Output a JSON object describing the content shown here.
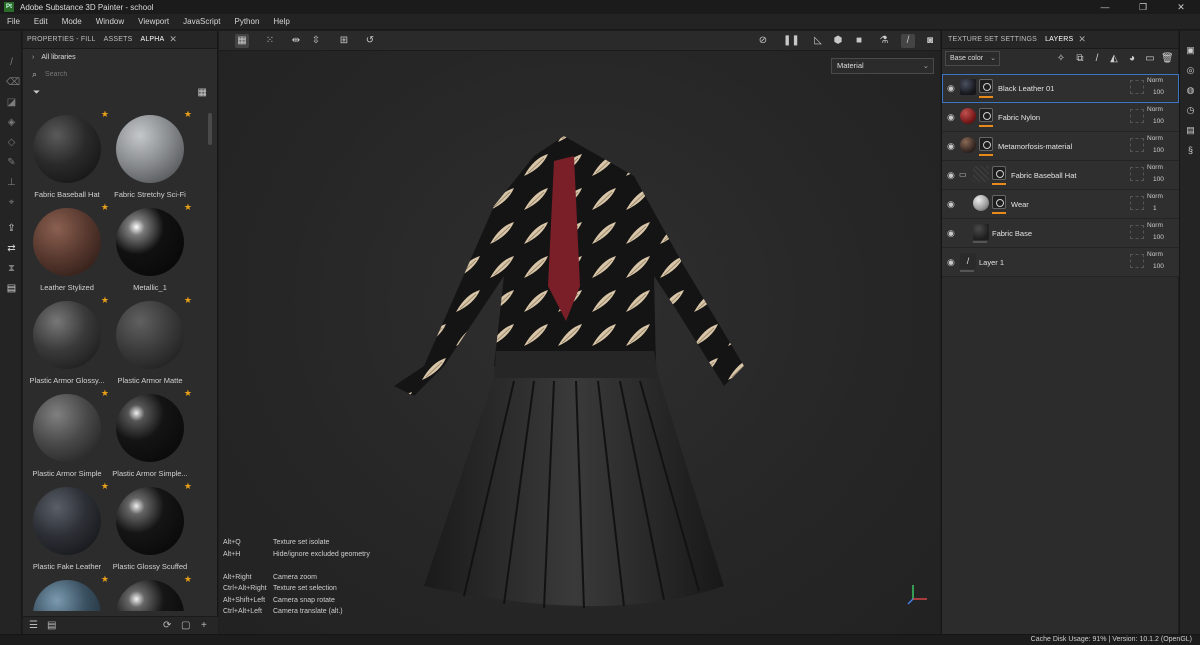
{
  "window": {
    "title": "Adobe Substance 3D Painter - school",
    "logo": "Pt"
  },
  "menu": [
    "File",
    "Edit",
    "Mode",
    "Window",
    "Viewport",
    "JavaScript",
    "Python",
    "Help"
  ],
  "props_panel": {
    "tabs": [
      {
        "label": "PROPERTIES - FILL"
      },
      {
        "label": "ASSETS"
      },
      {
        "label": "ALPHA"
      }
    ],
    "close": "✕",
    "library_label": "All libraries",
    "search_placeholder": "Search",
    "materials": [
      {
        "name": "Fabric Baseball Hat",
        "color": "#2a2a2a",
        "star": true
      },
      {
        "name": "Fabric Stretchy Sci-Fi",
        "color": "#8a8d90",
        "star": true
      },
      {
        "name": "Leather Stylized",
        "color": "#5a3a30",
        "star": true
      },
      {
        "name": "Metallic_1",
        "color": "#111111",
        "star": true
      },
      {
        "name": "Plastic Armor Glossy...",
        "color": "#3a3a3a",
        "star": true
      },
      {
        "name": "Plastic Armor Matte",
        "color": "#3c3c3c",
        "star": true
      },
      {
        "name": "Plastic Armor Simple",
        "color": "#4a4a4a",
        "star": true
      },
      {
        "name": "Plastic Armor Simple...",
        "color": "#141414",
        "star": true
      },
      {
        "name": "Plastic Fake Leather",
        "color": "#2c2f35",
        "star": true
      },
      {
        "name": "Plastic Glossy Scuffed",
        "color": "#151515",
        "star": true
      },
      {
        "name": "",
        "color": "#3a5060",
        "star": true
      },
      {
        "name": "",
        "color": "#161616",
        "star": true
      }
    ]
  },
  "viewport": {
    "channel": "Material",
    "shortcuts": [
      {
        "key": "Alt+Q",
        "desc": "Texture set isolate"
      },
      {
        "key": "Alt+H",
        "desc": "Hide/ignore excluded geometry"
      },
      {
        "key": "",
        "desc": ""
      },
      {
        "key": "Alt+Right",
        "desc": "Camera zoom"
      },
      {
        "key": "Ctrl+Alt+Right",
        "desc": "Texture set selection"
      },
      {
        "key": "Alt+Shift+Left",
        "desc": "Camera snap rotate"
      },
      {
        "key": "Ctrl+Alt+Left",
        "desc": "Camera translate (alt.)"
      }
    ]
  },
  "layers_panel": {
    "tabs": [
      {
        "label": "TEXTURE SET SETTINGS"
      },
      {
        "label": "LAYERS"
      }
    ],
    "close": "✕",
    "channel": "Base color",
    "layers": [
      {
        "name": "Black Leather 01",
        "blend": "Norm",
        "opacity": "100",
        "thumb": "#15151a",
        "selected": true
      },
      {
        "name": "Fabric Nylon",
        "blend": "Norm",
        "opacity": "100",
        "thumb": "#7a1a1a",
        "selected": false
      },
      {
        "name": "Metamorfosis-material",
        "blend": "Norm",
        "opacity": "100",
        "thumb": "#3a2a25",
        "selected": false
      },
      {
        "name": "Fabric Baseball Hat",
        "blend": "Norm",
        "opacity": "100",
        "thumb": "#3a3a3a",
        "selected": false
      },
      {
        "name": "Wear",
        "blend": "Norm",
        "opacity": "1",
        "thumb": "#bbbbbb",
        "selected": false
      },
      {
        "name": "Fabric Base",
        "blend": "Norm",
        "opacity": "100",
        "thumb": "#1e1e1e",
        "selected": false
      },
      {
        "name": "Layer 1",
        "blend": "Norm",
        "opacity": "100",
        "thumb": "#2a2a2a",
        "selected": false
      }
    ]
  },
  "status": {
    "text": "Cache Disk Usage:   91% | Version: 10.1.2 (OpenGL)"
  },
  "colors": {
    "accent": "#e8891c",
    "selection": "#3b76c4",
    "star": "#e8a018"
  }
}
